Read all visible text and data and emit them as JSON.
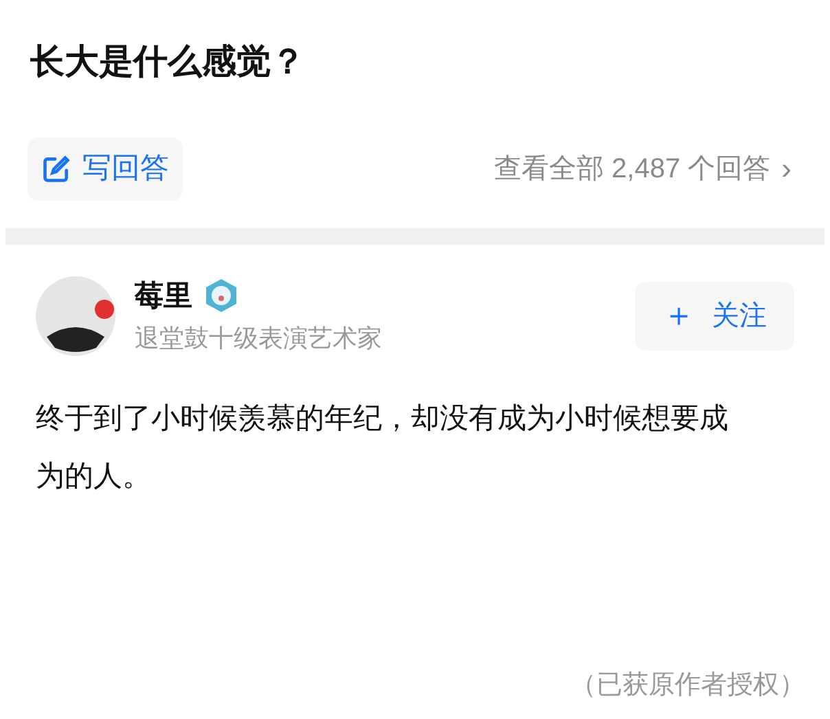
{
  "question": {
    "title": "长大是什么感觉？"
  },
  "actions": {
    "write_answer": "写回答",
    "view_all": "查看全部 2,487 个回答",
    "chevron": "›"
  },
  "answer": {
    "author": {
      "name": "莓里",
      "bio": "退堂鼓十级表演艺术家"
    },
    "follow_button": {
      "icon": "＋",
      "label": "关注"
    },
    "content": "终于到了小时候羡慕的年纪，却没有成为小时候想要成为的人。",
    "footnote": "（已获原作者授权）"
  }
}
